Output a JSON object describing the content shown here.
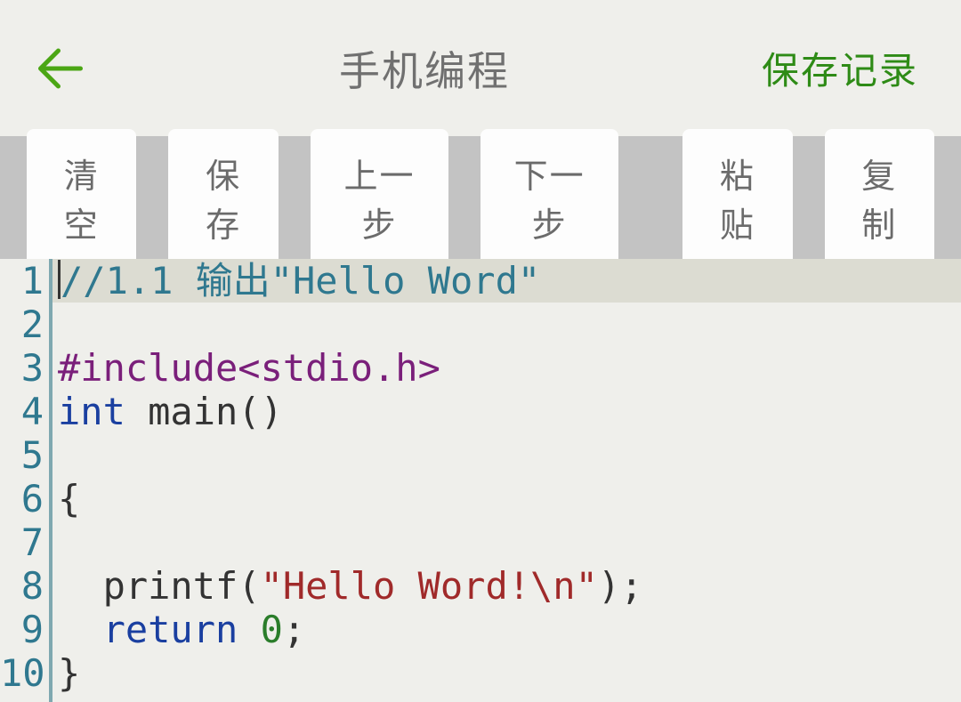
{
  "header": {
    "title": "手机编程",
    "save_record": "保存记录"
  },
  "toolbar": {
    "clear": "清空",
    "save": "保存",
    "undo": "上一步",
    "redo": "下一步",
    "paste": "粘贴",
    "copy": "复制"
  },
  "editor": {
    "line_numbers": [
      "1",
      "2",
      "3",
      "4",
      "5",
      "6",
      "7",
      "8",
      "9",
      "10"
    ],
    "line1_comment": "//1.1 输出\"Hello Word\"",
    "line3_include": "#include<stdio.h>",
    "line4_int": "int",
    "line4_rest": " main()",
    "line6_brace": "{",
    "line8_printf": "  printf(",
    "line8_string": "\"Hello Word!\\n\"",
    "line8_end": ");",
    "line9_ind": "  ",
    "line9_return": "return",
    "line9_sp": " ",
    "line9_zero": "0",
    "line9_semi": ";",
    "line10_brace": "}"
  }
}
